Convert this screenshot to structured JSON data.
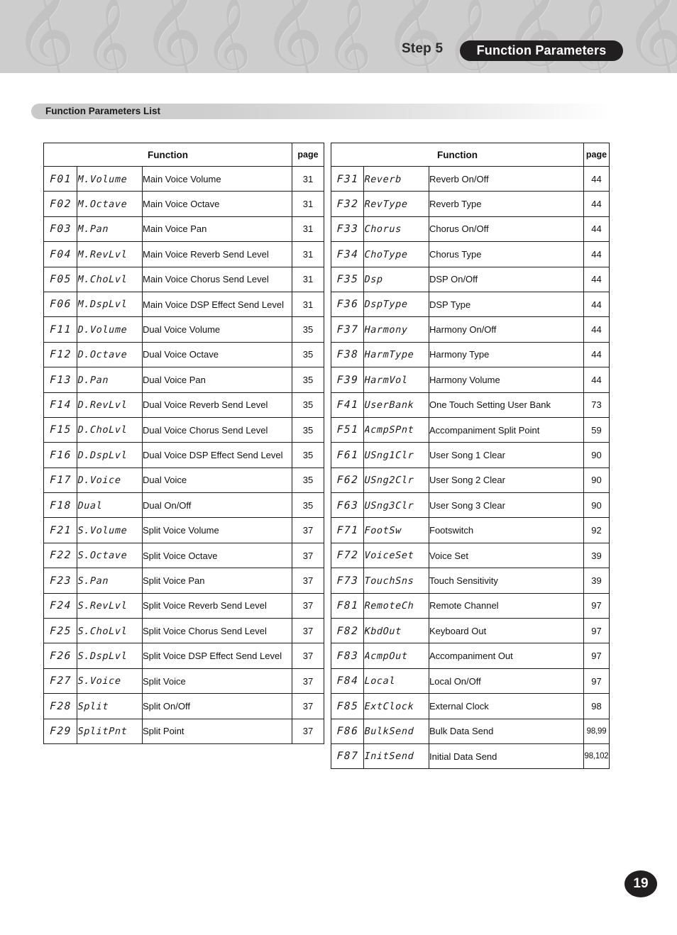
{
  "header": {
    "step_label": "Step 5",
    "chapter_title": "Function Parameters",
    "watermark_icon": "treble-clef-icon"
  },
  "section": {
    "title": "Function Parameters List"
  },
  "tables": {
    "column_headers": {
      "function": "Function",
      "page": "page"
    },
    "left": [
      {
        "code": "F01",
        "lcd": "M.Volume",
        "desc": "Main Voice Volume",
        "page": "31"
      },
      {
        "code": "F02",
        "lcd": "M.Octave",
        "desc": "Main Voice Octave",
        "page": "31"
      },
      {
        "code": "F03",
        "lcd": "M.Pan",
        "desc": "Main Voice Pan",
        "page": "31"
      },
      {
        "code": "F04",
        "lcd": "M.RevLvl",
        "desc": "Main Voice Reverb Send Level",
        "page": "31"
      },
      {
        "code": "F05",
        "lcd": "M.ChoLvl",
        "desc": "Main Voice Chorus Send Level",
        "page": "31"
      },
      {
        "code": "F06",
        "lcd": "M.DspLvl",
        "desc": "Main Voice DSP Effect Send Level",
        "page": "31"
      },
      {
        "code": "F11",
        "lcd": "D.Volume",
        "desc": "Dual Voice Volume",
        "page": "35"
      },
      {
        "code": "F12",
        "lcd": "D.Octave",
        "desc": "Dual Voice Octave",
        "page": "35"
      },
      {
        "code": "F13",
        "lcd": "D.Pan",
        "desc": "Dual Voice Pan",
        "page": "35"
      },
      {
        "code": "F14",
        "lcd": "D.RevLvl",
        "desc": "Dual Voice Reverb Send Level",
        "page": "35"
      },
      {
        "code": "F15",
        "lcd": "D.ChoLvl",
        "desc": "Dual Voice Chorus Send Level",
        "page": "35"
      },
      {
        "code": "F16",
        "lcd": "D.DspLvl",
        "desc": "Dual Voice DSP Effect Send Level",
        "page": "35"
      },
      {
        "code": "F17",
        "lcd": "D.Voice",
        "desc": "Dual Voice",
        "page": "35"
      },
      {
        "code": "F18",
        "lcd": "Dual",
        "desc": "Dual On/Off",
        "page": "35"
      },
      {
        "code": "F21",
        "lcd": "S.Volume",
        "desc": "Split Voice Volume",
        "page": "37"
      },
      {
        "code": "F22",
        "lcd": "S.Octave",
        "desc": "Split Voice Octave",
        "page": "37"
      },
      {
        "code": "F23",
        "lcd": "S.Pan",
        "desc": "Split Voice Pan",
        "page": "37"
      },
      {
        "code": "F24",
        "lcd": "S.RevLvl",
        "desc": "Split Voice Reverb Send Level",
        "page": "37"
      },
      {
        "code": "F25",
        "lcd": "S.ChoLvl",
        "desc": "Split Voice Chorus Send Level",
        "page": "37"
      },
      {
        "code": "F26",
        "lcd": "S.DspLvl",
        "desc": "Split Voice DSP Effect Send Level",
        "page": "37"
      },
      {
        "code": "F27",
        "lcd": "S.Voice",
        "desc": "Split Voice",
        "page": "37"
      },
      {
        "code": "F28",
        "lcd": "Split",
        "desc": "Split On/Off",
        "page": "37"
      },
      {
        "code": "F29",
        "lcd": "SplitPnt",
        "desc": "Split Point",
        "page": "37"
      }
    ],
    "right": [
      {
        "code": "F31",
        "lcd": "Reverb",
        "desc": "Reverb On/Off",
        "page": "44"
      },
      {
        "code": "F32",
        "lcd": "RevType",
        "desc": "Reverb Type",
        "page": "44"
      },
      {
        "code": "F33",
        "lcd": "Chorus",
        "desc": "Chorus On/Off",
        "page": "44"
      },
      {
        "code": "F34",
        "lcd": "ChoType",
        "desc": "Chorus Type",
        "page": "44"
      },
      {
        "code": "F35",
        "lcd": "Dsp",
        "desc": "DSP On/Off",
        "page": "44"
      },
      {
        "code": "F36",
        "lcd": "DspType",
        "desc": "DSP Type",
        "page": "44"
      },
      {
        "code": "F37",
        "lcd": "Harmony",
        "desc": "Harmony On/Off",
        "page": "44"
      },
      {
        "code": "F38",
        "lcd": "HarmType",
        "desc": "Harmony Type",
        "page": "44"
      },
      {
        "code": "F39",
        "lcd": "HarmVol",
        "desc": "Harmony Volume",
        "page": "44"
      },
      {
        "code": "F41",
        "lcd": "UserBank",
        "desc": "One Touch Setting User Bank",
        "page": "73"
      },
      {
        "code": "F51",
        "lcd": "AcmpSPnt",
        "desc": "Accompaniment Split Point",
        "page": "59"
      },
      {
        "code": "F61",
        "lcd": "USng1Clr",
        "desc": "User Song 1 Clear",
        "page": "90"
      },
      {
        "code": "F62",
        "lcd": "USng2Clr",
        "desc": "User Song 2 Clear",
        "page": "90"
      },
      {
        "code": "F63",
        "lcd": "USng3Clr",
        "desc": "User Song 3 Clear",
        "page": "90"
      },
      {
        "code": "F71",
        "lcd": "FootSw",
        "desc": "Footswitch",
        "page": "92"
      },
      {
        "code": "F72",
        "lcd": "VoiceSet",
        "desc": "Voice Set",
        "page": "39"
      },
      {
        "code": "F73",
        "lcd": "TouchSns",
        "desc": "Touch Sensitivity",
        "page": "39"
      },
      {
        "code": "F81",
        "lcd": "RemoteCh",
        "desc": "Remote Channel",
        "page": "97"
      },
      {
        "code": "F82",
        "lcd": "KbdOut",
        "desc": "Keyboard Out",
        "page": "97"
      },
      {
        "code": "F83",
        "lcd": "AcmpOut",
        "desc": "Accompaniment Out",
        "page": "97"
      },
      {
        "code": "F84",
        "lcd": "Local",
        "desc": "Local On/Off",
        "page": "97"
      },
      {
        "code": "F85",
        "lcd": "ExtClock",
        "desc": "External Clock",
        "page": "98"
      },
      {
        "code": "F86",
        "lcd": "BulkSend",
        "desc": "Bulk Data Send",
        "page": "98,99"
      },
      {
        "code": "F87",
        "lcd": "InitSend",
        "desc": "Initial Data Send",
        "page": "98,102"
      }
    ]
  },
  "footer": {
    "page_number": "19"
  }
}
